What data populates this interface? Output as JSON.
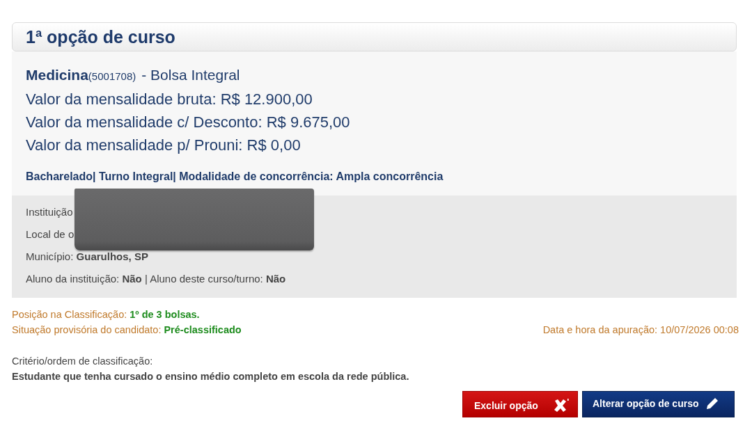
{
  "section": {
    "title": "1ª opção de curso"
  },
  "course": {
    "name": "Medicina",
    "code": "(5001708)",
    "scholarship": "- Bolsa Integral",
    "fees": [
      "Valor da mensalidade bruta: R$ 12.900,00",
      "Valor da mensalidade c/ Desconto: R$ 9.675,00",
      "Valor da mensalidade p/ Prouni: R$ 0,00"
    ],
    "details": "Bacharelado| Turno Integral| Modalidade de concorrência: Ampla concorrência"
  },
  "institution_info": [
    "Instituição",
    "Local de o",
    "Município: **Guarulhos, SP**",
    "Aluno da instituição: **Não** | Aluno deste curso/turno: **Não**"
  ],
  "classification": {
    "position": "Posição na Classificação: **1º de 3 bolsas.**",
    "status": "Situação provisória do candidato: **Pré-classificado**",
    "calculation_time": "Data e hora da apuração: 10/07/2026 00:08"
  },
  "criteria": {
    "label": "Critério/ordem de classificação:",
    "text": "Estudante que tenha cursado o ensino médio completo em escola da rede pública."
  },
  "buttons": [
    {
      "label": "Excluir opção",
      "kind": "delete"
    },
    {
      "label": "Alterar opção de curso",
      "kind": "edit"
    }
  ]
}
